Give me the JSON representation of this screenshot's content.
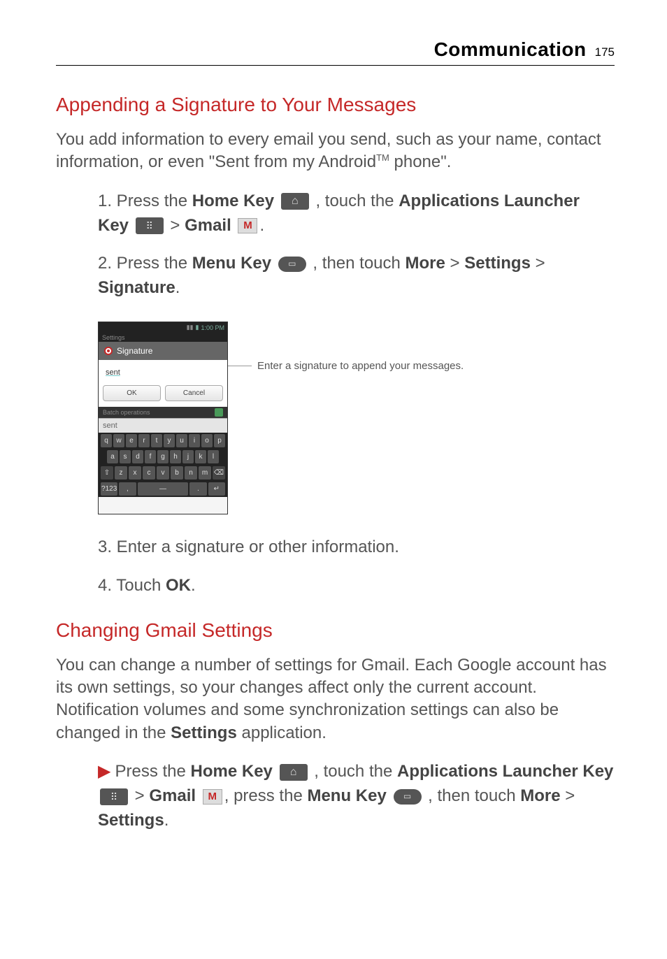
{
  "header": {
    "title": "Communication",
    "page": "175"
  },
  "section1": {
    "title": "Appending a Signature to Your Messages",
    "intro_a": "You add information to every email you send, such as your name, contact information, or even \"Sent from my Android",
    "intro_tm": "TM",
    "intro_b": " phone\".",
    "step1_a": "1. Press the ",
    "step1_b": "Home Key",
    "step1_c": " , touch the ",
    "step1_d": "Applications Launcher Key",
    "step1_e": " > ",
    "step1_f": "Gmail",
    "step1_g": ".",
    "step2_a": "2. Press the ",
    "step2_b": "Menu Key",
    "step2_c": " , then touch ",
    "step2_d": "More",
    "step2_e": " > ",
    "step2_f": "Settings",
    "step2_g": " > ",
    "step2_h": "Signature",
    "step2_i": ".",
    "step3": "3. Enter a signature or other information.",
    "step4_a": "4. Touch ",
    "step4_b": "OK",
    "step4_c": "."
  },
  "screenshot": {
    "time": "1:00 PM",
    "settings": "Settings",
    "dialog_title": "Signature",
    "input_value": "sent",
    "ok": "OK",
    "cancel": "Cancel",
    "batch": "Batch operations",
    "prediction": "sent",
    "row1": [
      "q",
      "w",
      "e",
      "r",
      "t",
      "y",
      "u",
      "i",
      "o",
      "p"
    ],
    "row2": [
      "a",
      "s",
      "d",
      "f",
      "g",
      "h",
      "j",
      "k",
      "l"
    ],
    "row3": [
      "⇧",
      "z",
      "x",
      "c",
      "v",
      "b",
      "n",
      "m",
      "⌫"
    ],
    "row4": [
      "?123",
      ",",
      "—",
      ".",
      "↵"
    ]
  },
  "callout": "Enter a signature to append your messages.",
  "section2": {
    "title": "Changing Gmail Settings",
    "body_a": "You can change a number of settings for Gmail. Each Google account has its own settings, so your changes affect only the current account. Notification volumes and some synchronization settings can also be changed in the ",
    "body_b": "Settings",
    "body_c": " application.",
    "bullet_a": "Press the ",
    "bullet_b": "Home Key",
    "bullet_c": " , touch the ",
    "bullet_d": "Applications Launcher Key",
    "bullet_e": " > ",
    "bullet_f": "Gmail",
    "bullet_g": ", press the ",
    "bullet_h": "Menu Key",
    "bullet_i": " , then touch ",
    "bullet_j": "More",
    "bullet_k": " > ",
    "bullet_l": "Settings",
    "bullet_m": "."
  }
}
